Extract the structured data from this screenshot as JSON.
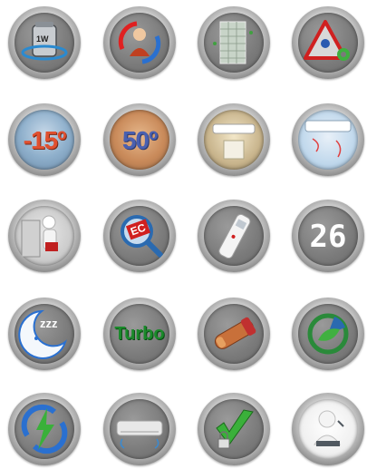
{
  "icons": [
    {
      "name": "one-watt-standby-icon",
      "label": "1W"
    },
    {
      "name": "self-diagnosis-person-icon"
    },
    {
      "name": "filter-panel-icon"
    },
    {
      "name": "warning-triangle-gear-icon"
    },
    {
      "name": "low-temperature-icon",
      "label": "-15º"
    },
    {
      "name": "high-temperature-icon",
      "label": "50º"
    },
    {
      "name": "indoor-unit-photo-icon"
    },
    {
      "name": "wall-unit-airflow-icon"
    },
    {
      "name": "technician-repair-icon"
    },
    {
      "name": "ec-magnifier-icon",
      "label": "EC"
    },
    {
      "name": "remote-control-icon"
    },
    {
      "name": "temperature-display-icon",
      "label": "26"
    },
    {
      "name": "sleep-mode-moon-icon",
      "label": "zzz"
    },
    {
      "name": "turbo-mode-icon",
      "label": "Turbo"
    },
    {
      "name": "copper-pipe-icon"
    },
    {
      "name": "eco-leaf-icon"
    },
    {
      "name": "auto-restart-bolt-icon"
    },
    {
      "name": "air-conditioner-unit-icon"
    },
    {
      "name": "lock-checkmark-icon"
    },
    {
      "name": "support-agent-icon"
    }
  ]
}
